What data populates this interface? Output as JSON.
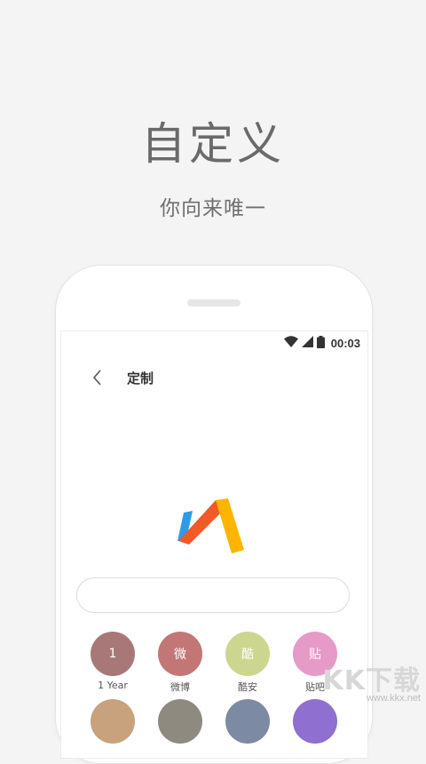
{
  "hero": {
    "title": "自定义",
    "subtitle": "你向来唯一"
  },
  "status_bar": {
    "time": "00:03",
    "icons": [
      "wifi-icon",
      "signal-icon",
      "battery-icon"
    ]
  },
  "nav": {
    "title": "定制",
    "back_icon": "chevron-left-icon"
  },
  "search": {
    "placeholder": "",
    "value": ""
  },
  "presets": [
    {
      "glyph": "1",
      "label": "1 Year",
      "color": "#a87878"
    },
    {
      "glyph": "微",
      "label": "微博",
      "color": "#c27676"
    },
    {
      "glyph": "酷",
      "label": "酷安",
      "color": "#ccd68f"
    },
    {
      "glyph": "贴",
      "label": "贴吧",
      "color": "#e59ac8"
    },
    {
      "glyph": "",
      "label": "",
      "color": "#c8a17d"
    },
    {
      "glyph": "",
      "label": "",
      "color": "#8f8a80"
    },
    {
      "glyph": "",
      "label": "",
      "color": "#7d8aa3"
    },
    {
      "glyph": "",
      "label": "",
      "color": "#8f6fcf"
    }
  ],
  "watermark": {
    "text": "KK下载",
    "url": "www.kkx.net"
  },
  "colors": {
    "background": "#f4f4f4",
    "logo_blue": "#2e9bea",
    "logo_red": "#f05a24",
    "logo_yellow": "#ffb400"
  }
}
